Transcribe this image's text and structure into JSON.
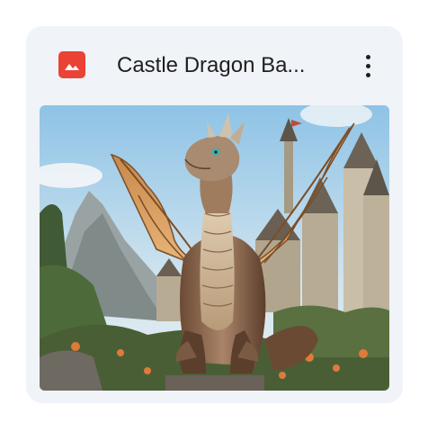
{
  "file": {
    "name": "Castle Dragon Ba...",
    "type_icon": "image-icon",
    "type_color": "#ea4335"
  },
  "menu": {
    "icon": "more-vert-icon"
  },
  "thumbnail": {
    "subject": "dragon-castle-illustration"
  },
  "colors": {
    "card_bg": "#f0f3f8",
    "text": "#1f1f1f"
  }
}
